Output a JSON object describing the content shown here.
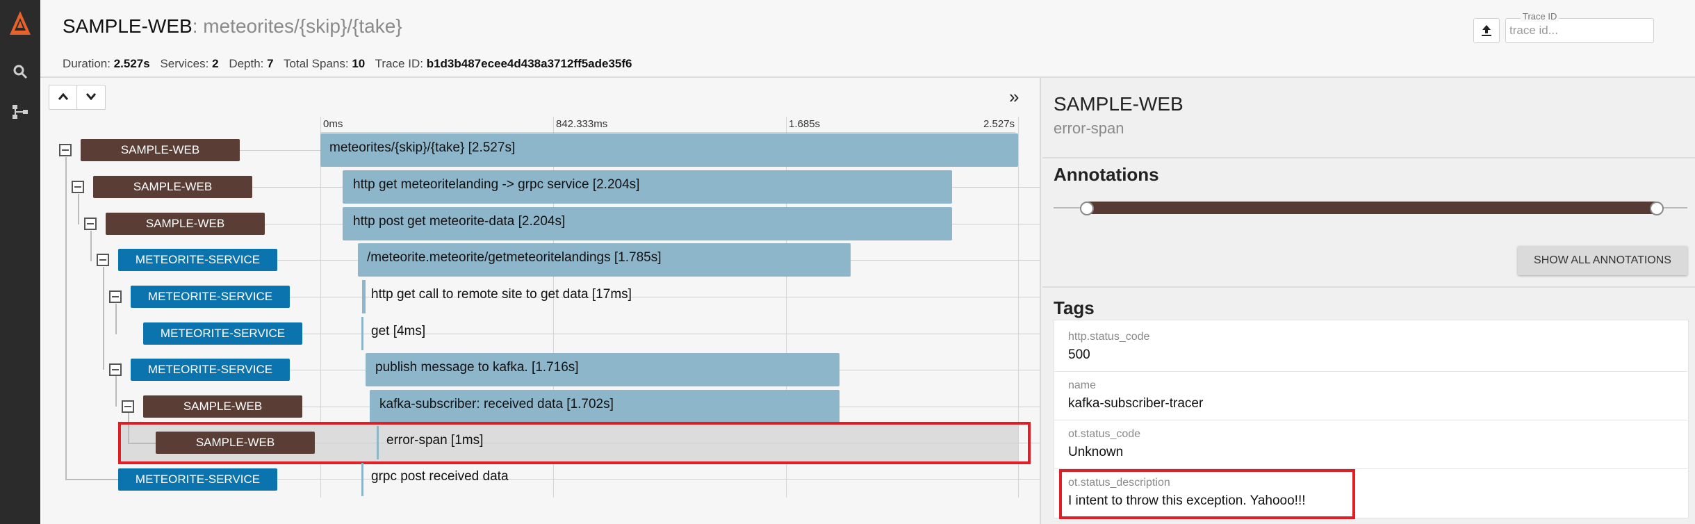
{
  "header": {
    "service_name": "SAMPLE-WEB",
    "operation": ": meteorites/{skip}/{take}",
    "duration_label": "Duration:",
    "duration": "2.527s",
    "services_label": "Services:",
    "services": "2",
    "depth_label": "Depth:",
    "depth": "7",
    "spans_label": "Total Spans:",
    "spans": "10",
    "traceid_label": "Trace ID:",
    "traceid": "b1d3b487ecee4d438a3712ff5ade35f6",
    "search_label": "Trace ID",
    "search_placeholder": "trace id..."
  },
  "ticks": [
    "0ms",
    "842.333ms",
    "1.685s",
    "2.527s"
  ],
  "spans": [
    {
      "service": "SAMPLE-WEB",
      "label": "meteorites/{skip}/{take} [2.527s]"
    },
    {
      "service": "SAMPLE-WEB",
      "label": "http get meteoritelanding -> grpc service [2.204s]"
    },
    {
      "service": "SAMPLE-WEB",
      "label": "http post get meteorite-data [2.204s]"
    },
    {
      "service": "METEORITE-SERVICE",
      "label": "/meteorite.meteorite/getmeteoritelandings [1.785s]"
    },
    {
      "service": "METEORITE-SERVICE",
      "label": "http get call to remote site to get data [17ms]"
    },
    {
      "service": "METEORITE-SERVICE",
      "label": "get [4ms]"
    },
    {
      "service": "METEORITE-SERVICE",
      "label": "publish message to kafka. [1.716s]"
    },
    {
      "service": "SAMPLE-WEB",
      "label": "kafka-subscriber: received data [1.702s]"
    },
    {
      "service": "SAMPLE-WEB",
      "label": "error-span [1ms]"
    },
    {
      "service": "METEORITE-SERVICE",
      "label": "grpc post received data"
    }
  ],
  "detail": {
    "service": "SAMPLE-WEB",
    "span_name": "error-span",
    "annotations_heading": "Annotations",
    "show_all_button": "SHOW ALL ANNOTATIONS",
    "tags_heading": "Tags",
    "tags": [
      {
        "key": "http.status_code",
        "value": "500"
      },
      {
        "key": "name",
        "value": "kafka-subscriber-tracer"
      },
      {
        "key": "ot.status_code",
        "value": "Unknown"
      },
      {
        "key": "ot.status_description",
        "value": "I intent to throw this exception. Yahooo!!!"
      }
    ]
  },
  "colors": {
    "sample_web": "#5a3e36",
    "meteorite_service": "#0b73ad",
    "bar": "#8eb6ca",
    "highlight": "#e01e26"
  },
  "icons": [
    "logo-icon",
    "search-icon",
    "dependencies-icon",
    "upload-icon",
    "chevron-up-icon",
    "chevron-down-icon",
    "expand-panel-icon"
  ]
}
